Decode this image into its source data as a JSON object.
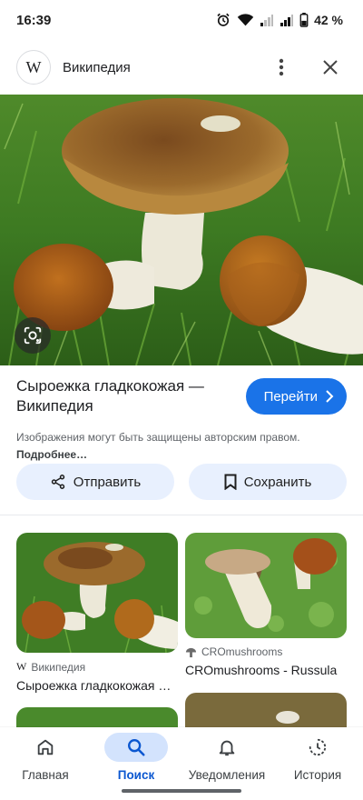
{
  "status_bar": {
    "time": "16:39",
    "battery": "42 %"
  },
  "top_bar": {
    "logo_letter": "W",
    "site_name": "Википедия"
  },
  "result": {
    "title": "Сыроежка гладкокожая — Википедия",
    "open_button": "Перейти",
    "notice": "Изображения могут быть защищены авторским правом.",
    "notice_link": "Подробнее…"
  },
  "actions": {
    "share": "Отправить",
    "save": "Сохранить"
  },
  "related": [
    {
      "source": "Википедия",
      "caption": "Сыроежка гладкокожая — Википедия"
    },
    {
      "source": "CROmushrooms",
      "caption": "CROmushrooms - Russula"
    }
  ],
  "bottom_nav": [
    {
      "label": "Главная",
      "icon": "home-icon"
    },
    {
      "label": "Поиск",
      "icon": "search-icon",
      "active": true
    },
    {
      "label": "Уведомления",
      "icon": "bell-icon"
    },
    {
      "label": "История",
      "icon": "history-icon"
    }
  ],
  "colors": {
    "accent": "#1a73e8",
    "pill_bg": "#e8f0fe",
    "nav_active_bg": "#d3e3fd"
  }
}
